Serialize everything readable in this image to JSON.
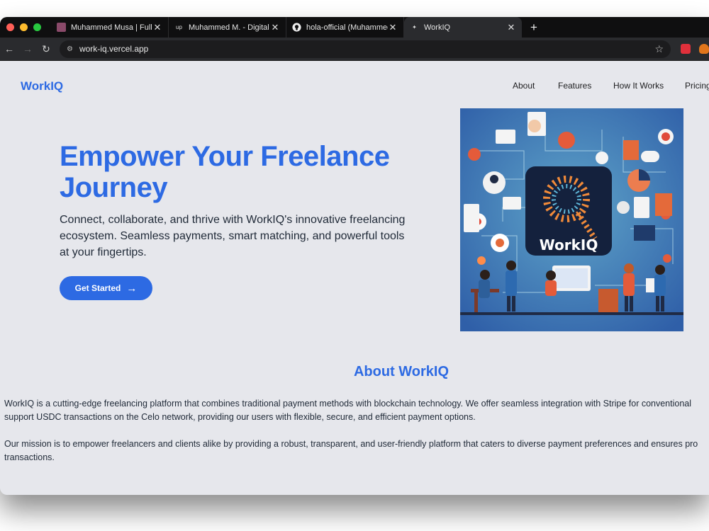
{
  "browser": {
    "tabs": [
      {
        "title": "Muhammed Musa | Full-Stack",
        "favicon": "profile-photo-icon",
        "active": false
      },
      {
        "title": "Muhammed M. - Digital Marke",
        "favicon": "upwork-icon",
        "active": false
      },
      {
        "title": "hola-official (Muhammed Mus",
        "favicon": "github-icon",
        "active": false
      },
      {
        "title": "WorkIQ",
        "favicon": "workiq-favicon",
        "active": true
      }
    ],
    "url": "work-iq.vercel.app"
  },
  "site": {
    "logo": "WorkIQ",
    "nav": [
      "About",
      "Features",
      "How It Works",
      "Pricing"
    ]
  },
  "hero": {
    "title": "Empower Your Freelance Journey",
    "subtitle": "Connect, collaborate, and thrive with WorkIQ's innovative freelancing ecosystem. Seamless payments, smart matching, and powerful tools at your fingertips.",
    "cta": "Get Started",
    "image_label": "WorkIQ"
  },
  "about": {
    "title": "About WorkIQ",
    "p1": "WorkIQ is a cutting-edge freelancing platform that combines traditional payment methods with blockchain technology. We offer seamless integration with Stripe for conventional support USDC transactions on the Celo network, providing our users with flexible, secure, and efficient payment options.",
    "p2": "Our mission is to empower freelancers and clients alike by providing a robust, transparent, and user-friendly platform that caters to diverse payment preferences and ensures pro transactions."
  },
  "colors": {
    "brand": "#2d6ae3",
    "page_bg": "#e6e7ec",
    "tab_bg": "#0f0f10"
  }
}
